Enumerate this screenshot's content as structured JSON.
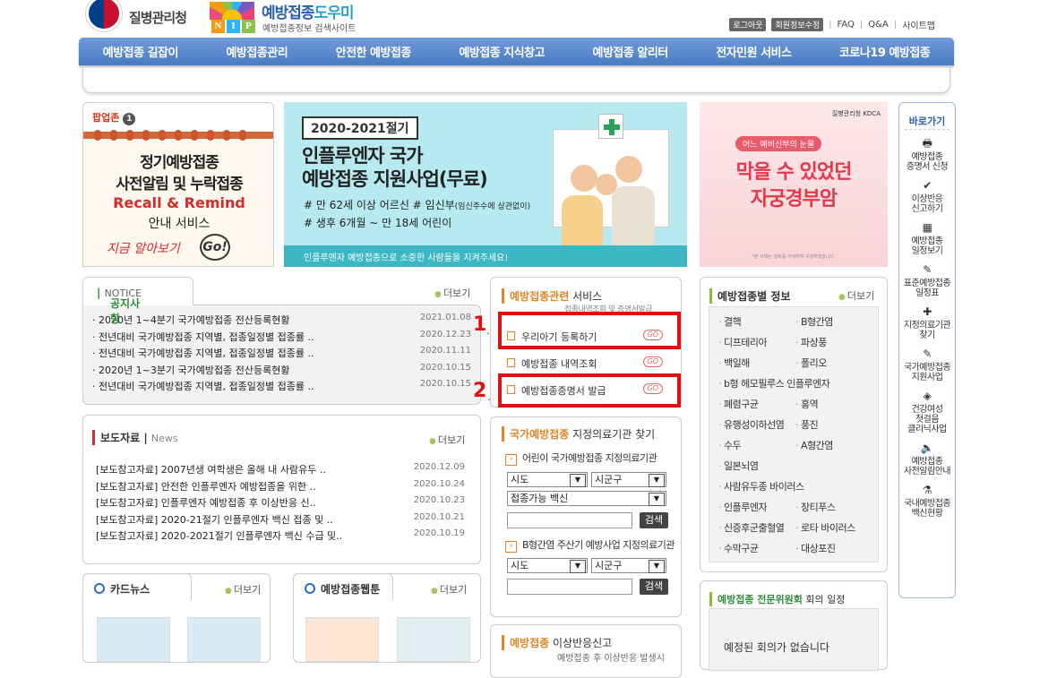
{
  "header": {
    "org_name": "질병관리청",
    "site_title_a": "예방접종",
    "site_title_b": "도우미",
    "site_subtitle": "예방접종정보 검색사이트",
    "nip_letters": [
      "N",
      "I",
      "P"
    ],
    "util": {
      "logout": "로그아웃",
      "member_edit": "회원정보수정",
      "faq": "FAQ",
      "qa": "Q&A",
      "sitemap": "사이트맵",
      "sep": "|"
    }
  },
  "nav": [
    "예방접종 길잡이",
    "예방접종관리",
    "안전한 예방접종",
    "예방접종 지식창고",
    "예방접종 알리터",
    "전자민원 서비스",
    "코로나19 예방접종"
  ],
  "popup_zone": {
    "title": "팝업존",
    "count": "1",
    "banner": {
      "line1": "정기예방접종",
      "line2": "사전알림 및 누락접종",
      "line3": "Recall & Remind",
      "line4": "안내 서비스",
      "line5": "지금 알아보기",
      "go": "Go!"
    }
  },
  "flu_banner": {
    "tag": "2020-2021절기",
    "title1": "인플루엔자 국가",
    "title2": "예방접종 지원사업(무료)",
    "line1": "# 만 62세 이상 어르신 # 임신부",
    "line1_small": "(임신주수에 상관없이)",
    "line2": "# 생후 6개월 ~ 만 18세 어린이",
    "footer": "인플루엔자 예방접종으로 소중한 사람들을 지켜주세요!"
  },
  "hpv_banner": {
    "logo": "질병관리청 KDCA",
    "pill": "어느 예비신부의 눈물",
    "title1": "막을 수 있었던",
    "title2": "자궁경부암",
    "footnote": "*본 사례는 실화를 각색하여 구성하였습니다."
  },
  "quick": {
    "title": "바로가기",
    "items": [
      {
        "icon": "printer-icon",
        "glyph": "🖶",
        "label": "예방접종\n증명서 신청"
      },
      {
        "icon": "check-icon",
        "glyph": "✔",
        "label": "이상반응\n신고하기"
      },
      {
        "icon": "calendar-icon",
        "glyph": "▦",
        "label": "예방접종\n일정보기"
      },
      {
        "icon": "syringe-icon",
        "glyph": "✎",
        "label": "표준예방접종\n일정표"
      },
      {
        "icon": "hospital-icon",
        "glyph": "✚",
        "label": "지정의료기관\n찾기"
      },
      {
        "icon": "document-icon",
        "glyph": "✎",
        "label": "국가예방접종\n지원사업"
      },
      {
        "icon": "box-icon",
        "glyph": "◈",
        "label": "건강여성\n첫걸음\n클리닉사업"
      },
      {
        "icon": "speaker-icon",
        "glyph": "🔈",
        "label": "예방접종\n사전알림안내"
      },
      {
        "icon": "vial-icon",
        "glyph": "⚗",
        "label": "국내예방접종\n백신현황"
      }
    ]
  },
  "notice": {
    "title": "공지사항",
    "title_en": "NOTICE",
    "more": "더보기",
    "items": [
      {
        "text": "· 2020년 1~4분기 국가예방접종 전산등록현황",
        "date": "2021.01.08"
      },
      {
        "text": "· 전년대비 국가예방접종 지역별, 접종일정별 접종률 ..",
        "date": "2020.12.23"
      },
      {
        "text": "· 전년대비 국가예방접종 지역별, 접종일정별 접종률 ..",
        "date": "2020.11.11"
      },
      {
        "text": "· 2020년 1~3분기 국가예방접종 전산등록현황",
        "date": "2020.10.15"
      },
      {
        "text": "· 전년대비 국가예방접종 지역별, 접종일정별 접종률 ..",
        "date": "2020.10.15"
      }
    ]
  },
  "press": {
    "title": "보도자료",
    "title_en": "News",
    "more": "더보기",
    "items": [
      {
        "text": "[보도참고자료] 2007년생 여학생은 올해 내 사람유두 ..",
        "date": "2020.12.09"
      },
      {
        "text": "[보도참고자료] 안전한 인플루엔자 예방접종을 위한 ..",
        "date": "2020.10.24"
      },
      {
        "text": "[보도참고자료] 인플루엔자 예방접종 후 이상반응 신..",
        "date": "2020.10.23"
      },
      {
        "text": "[보도참고자료] 2020-21절기 인플루엔자 백신 접종 및 ..",
        "date": "2020.10.21"
      },
      {
        "text": "[보도참고자료] 2020-2021절기 인플루엔자 백신 수급 및..",
        "date": "2020.10.19"
      }
    ]
  },
  "card_news": {
    "title": "카드뉴스",
    "more": "더보기"
  },
  "webtoon": {
    "title": "예방접종웹툰",
    "more": "더보기"
  },
  "service": {
    "title_bold": "예방접종관련",
    "title_rest": " 서비스",
    "sub": "접종내역조회 및 증명서발급",
    "items": [
      "우리아기 등록하기",
      "예방접종 내역조회",
      "예방접종증명서 발급"
    ],
    "go": "GO",
    "annotations": {
      "n1": "1",
      "n2": "2",
      "dot": "."
    }
  },
  "hospital_search": {
    "title_bold": "국가예방접종",
    "title_rest": " 지정의료기관 찾기",
    "child_label": "어린이 국가예방접종 지정의료기관",
    "sido": "시도",
    "sigungu": "시군구",
    "vaccine": "접종가능 백신",
    "search": "검색",
    "hepb_label": "B형간염 주산기 예방사업 지정의료기관"
  },
  "adverse": {
    "title_bold": "예방접종",
    "title_rest": " 이상반응신고",
    "sub": "예방접종 후 이상반응 발생시"
  },
  "vaccine_info": {
    "title": "예방접종별 정보",
    "more": "더보기",
    "left": [
      "결핵",
      "디프테리아",
      "백일해",
      "b형 헤모필루스 인플루엔자",
      "폐렴구균",
      "유행성이하선염",
      "수두",
      "일본뇌염",
      "사람유두종 바이러스",
      "인플루엔자",
      "신증후군출혈열",
      "수막구균"
    ],
    "right": [
      "B형간염",
      "파상풍",
      "폴리오",
      "",
      "홍역",
      "풍진",
      "A형간염",
      "",
      "",
      "장티푸스",
      "로타 바이러스",
      "대상포진"
    ]
  },
  "committee": {
    "title_bold": "예방접종 전문위원회",
    "title_rest": " 회의 일정",
    "empty": "예정된 회의가 없습니다"
  }
}
